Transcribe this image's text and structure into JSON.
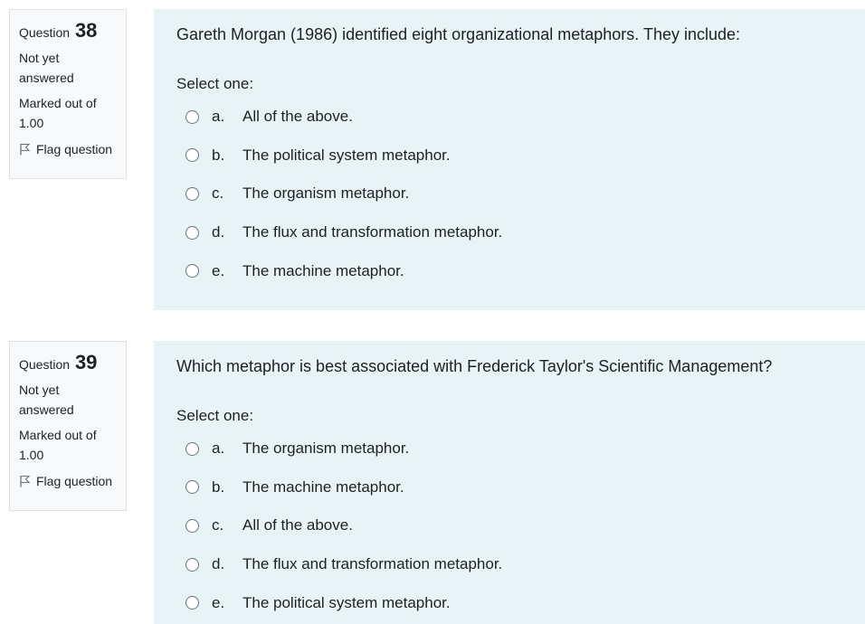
{
  "questions": [
    {
      "label": "Question",
      "number": "38",
      "state": "Not yet answered",
      "marked_label": "Marked out of",
      "marked_value": "1.00",
      "flag_label": "Flag question",
      "text": "Gareth Morgan (1986) identified eight organizational metaphors. They include:",
      "prompt": "Select one:",
      "options": [
        {
          "letter": "a.",
          "text": "All of the above."
        },
        {
          "letter": "b.",
          "text": "The political system metaphor."
        },
        {
          "letter": "c.",
          "text": "The organism metaphor."
        },
        {
          "letter": "d.",
          "text": "The flux and transformation metaphor."
        },
        {
          "letter": "e.",
          "text": "The machine metaphor."
        }
      ]
    },
    {
      "label": "Question",
      "number": "39",
      "state": "Not yet answered",
      "marked_label": "Marked out of",
      "marked_value": "1.00",
      "flag_label": "Flag question",
      "text": "Which metaphor is best associated with Frederick Taylor's Scientific Management?",
      "prompt": "Select one:",
      "options": [
        {
          "letter": "a.",
          "text": "The organism metaphor."
        },
        {
          "letter": "b.",
          "text": "The machine metaphor."
        },
        {
          "letter": "c.",
          "text": "All of the above."
        },
        {
          "letter": "d.",
          "text": "The flux and transformation metaphor."
        },
        {
          "letter": "e.",
          "text": "The political system metaphor."
        }
      ]
    }
  ],
  "icons": {
    "flag": "flag-icon",
    "radio": "radio-button-icon"
  }
}
